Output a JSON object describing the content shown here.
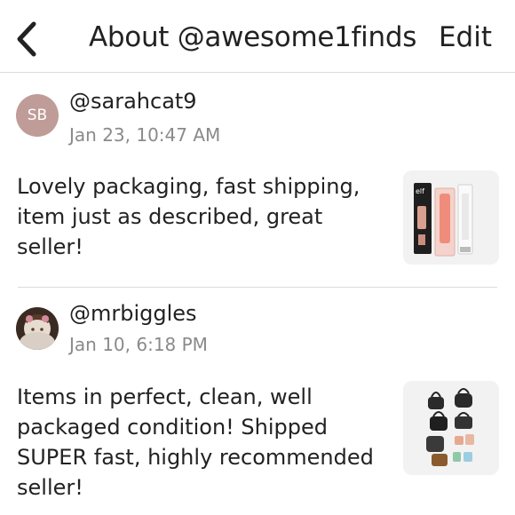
{
  "header": {
    "back_icon": "chevron-left-icon",
    "title": "About @awesome1finds",
    "edit_label": "Edit"
  },
  "reviews": [
    {
      "username": "@sarahcat9",
      "avatar_initials": "SB",
      "avatar_color": "#bf9c97",
      "timestamp": "Jan 23, 10:47 AM",
      "text": "Lovely packaging, fast shipping, item just as described, great seller!",
      "thumbnail_icon": "makeup-products-photo"
    },
    {
      "username": "@mrbiggles",
      "avatar_initials": "",
      "timestamp": "Jan 10, 6:18 PM",
      "text": "Items in perfect, clean, well packaged condition! Shipped SUPER fast, highly recommended seller!",
      "thumbnail_icon": "mini-bags-photo"
    }
  ]
}
